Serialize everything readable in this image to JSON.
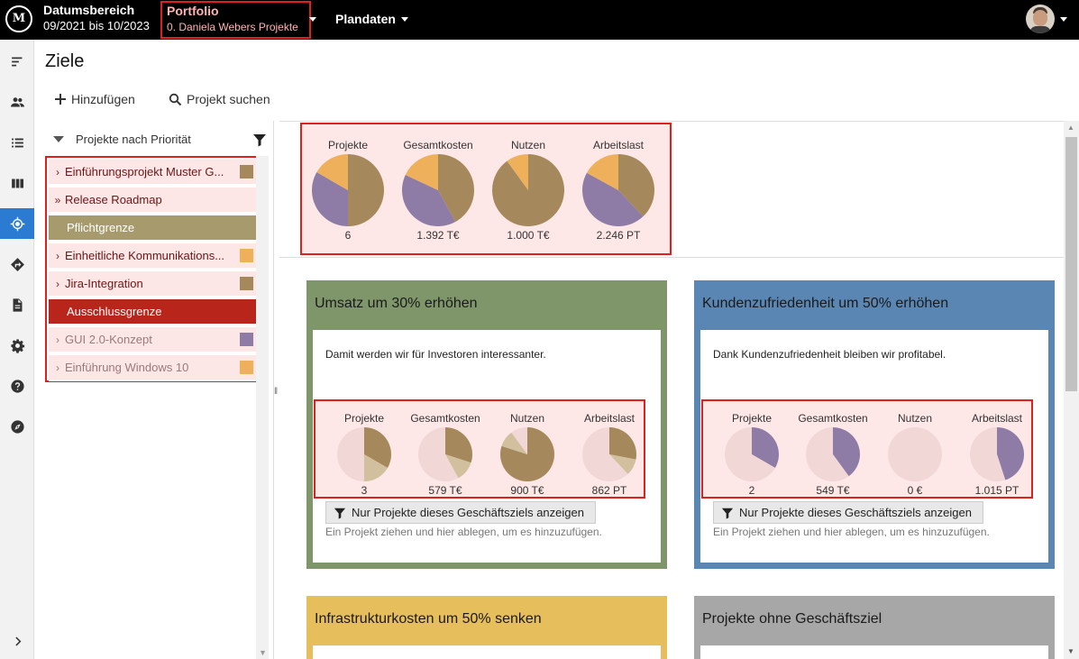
{
  "colors": {
    "topbar_bg": "#000000",
    "highlight_border": "#e0201d",
    "pie_brown": "#a5895c",
    "pie_orange": "#eeb05a",
    "pie_purple": "#8f7ca6",
    "pie_tan": "#d2bf9e",
    "pie_pink": "#f2d7d7",
    "card_green": "#7f966a",
    "card_blue": "#5a86b4",
    "card_yellow": "#e7be5c",
    "card_gray": "#a7a7a7",
    "band_pflicht": "#a79b6e",
    "band_ausschluss": "#b8261b",
    "rail_active": "#2a7bd1"
  },
  "header": {
    "logo_text": "M",
    "date_label": "Datumsbereich",
    "date_value": "09/2021 bis 10/2023",
    "portfolio_label": "Portfolio",
    "portfolio_value": "0. Daniela Webers Projekte",
    "plandaten_label": "Plandaten"
  },
  "rail": {
    "icons": [
      "menu-icon",
      "people-icon",
      "list-icon",
      "columns-icon",
      "target-icon",
      "directions-icon",
      "document-icon",
      "gear-icon",
      "help-icon",
      "compass-icon",
      "expand-icon"
    ],
    "active": "target-icon"
  },
  "page": {
    "title": "Ziele",
    "add_label": "Hinzufügen",
    "search_label": "Projekt suchen"
  },
  "project_list": {
    "sort_label": "Projekte nach Priorität",
    "rows": [
      {
        "kind": "project",
        "chev": "›",
        "name": "Einführungsprojekt Muster G...",
        "color": "#a5895c",
        "muted": false
      },
      {
        "kind": "project",
        "chev": "»",
        "name": "Release Roadmap",
        "color": "",
        "muted": false
      },
      {
        "kind": "band",
        "name": "Pflichtgrenze",
        "color": "#a79b6e"
      },
      {
        "kind": "project",
        "chev": "›",
        "name": "Einheitliche Kommunikations...",
        "color": "#eeb05a",
        "muted": false
      },
      {
        "kind": "project",
        "chev": "›",
        "name": "Jira-Integration",
        "color": "#a5895c",
        "muted": false
      },
      {
        "kind": "band",
        "name": "Ausschlussgrenze",
        "color": "#b8261b"
      },
      {
        "kind": "project",
        "chev": "›",
        "name": "GUI 2.0-Konzept",
        "color": "#8f7ca6",
        "muted": true
      },
      {
        "kind": "project",
        "chev": "›",
        "name": "Einführung Windows 10",
        "color": "#eeb05a",
        "muted": true
      }
    ]
  },
  "summary": {
    "pies": [
      {
        "label": "Projekte",
        "value": "6",
        "slices": [
          {
            "color": "#a5895c",
            "fraction": 0.5
          },
          {
            "color": "#8f7ca6",
            "fraction": 0.3333
          },
          {
            "color": "#eeb05a",
            "fraction": 0.1667
          }
        ]
      },
      {
        "label": "Gesamtkosten",
        "value": "1.392 T€",
        "slices": [
          {
            "color": "#a5895c",
            "fraction": 0.42
          },
          {
            "color": "#8f7ca6",
            "fraction": 0.4
          },
          {
            "color": "#eeb05a",
            "fraction": 0.18
          }
        ]
      },
      {
        "label": "Nutzen",
        "value": "1.000 T€",
        "slices": [
          {
            "color": "#a5895c",
            "fraction": 0.9
          },
          {
            "color": "#eeb05a",
            "fraction": 0.1
          }
        ]
      },
      {
        "label": "Arbeitslast",
        "value": "2.246 PT",
        "slices": [
          {
            "color": "#a5895c",
            "fraction": 0.38
          },
          {
            "color": "#8f7ca6",
            "fraction": 0.45
          },
          {
            "color": "#eeb05a",
            "fraction": 0.17
          }
        ]
      }
    ]
  },
  "goals": [
    {
      "title": "Umsatz um 30% erhöhen",
      "color": "#7f966a",
      "description": "Damit werden wir für Investoren interessanter.",
      "button": "Nur Projekte dieses Geschäftsziels anzeigen",
      "hint": "Ein Projekt ziehen und hier ablegen, um es hinzuzufügen.",
      "pies": [
        {
          "label": "Projekte",
          "value": "3",
          "slices": [
            {
              "color": "#a5895c",
              "fraction": 0.3333
            },
            {
              "color": "#d2bf9e",
              "fraction": 0.1667
            },
            {
              "color": "#f2d7d7",
              "fraction": 0.5
            }
          ]
        },
        {
          "label": "Gesamtkosten",
          "value": "579 T€",
          "slices": [
            {
              "color": "#a5895c",
              "fraction": 0.3
            },
            {
              "color": "#d2bf9e",
              "fraction": 0.12
            },
            {
              "color": "#f2d7d7",
              "fraction": 0.58
            }
          ]
        },
        {
          "label": "Nutzen",
          "value": "900 T€",
          "slices": [
            {
              "color": "#a5895c",
              "fraction": 0.8
            },
            {
              "color": "#d2bf9e",
              "fraction": 0.1
            },
            {
              "color": "#f2d7d7",
              "fraction": 0.1
            }
          ]
        },
        {
          "label": "Arbeitslast",
          "value": "862 PT",
          "slices": [
            {
              "color": "#a5895c",
              "fraction": 0.28
            },
            {
              "color": "#d2bf9e",
              "fraction": 0.1
            },
            {
              "color": "#f2d7d7",
              "fraction": 0.62
            }
          ]
        }
      ]
    },
    {
      "title": "Kundenzufriedenheit um 50% erhöhen",
      "color": "#5a86b4",
      "description": "Dank Kundenzufriedenheit bleiben wir profitabel.",
      "button": "Nur Projekte dieses Geschäftsziels anzeigen",
      "hint": "Ein Projekt ziehen und hier ablegen, um es hinzuzufügen.",
      "pies": [
        {
          "label": "Projekte",
          "value": "2",
          "slices": [
            {
              "color": "#8f7ca6",
              "fraction": 0.3333
            },
            {
              "color": "#f2d7d7",
              "fraction": 0.6667
            }
          ]
        },
        {
          "label": "Gesamtkosten",
          "value": "549 T€",
          "slices": [
            {
              "color": "#8f7ca6",
              "fraction": 0.4
            },
            {
              "color": "#f2d7d7",
              "fraction": 0.6
            }
          ]
        },
        {
          "label": "Nutzen",
          "value": "0 €",
          "slices": [
            {
              "color": "#f2d7d7",
              "fraction": 1.0
            }
          ]
        },
        {
          "label": "Arbeitslast",
          "value": "1.015 PT",
          "slices": [
            {
              "color": "#8f7ca6",
              "fraction": 0.45
            },
            {
              "color": "#f2d7d7",
              "fraction": 0.55
            }
          ]
        }
      ]
    },
    {
      "title": "Infrastrukturkosten um 50% senken",
      "color": "#e7be5c"
    },
    {
      "title": "Projekte ohne Geschäftsziel",
      "color": "#a7a7a7"
    }
  ]
}
